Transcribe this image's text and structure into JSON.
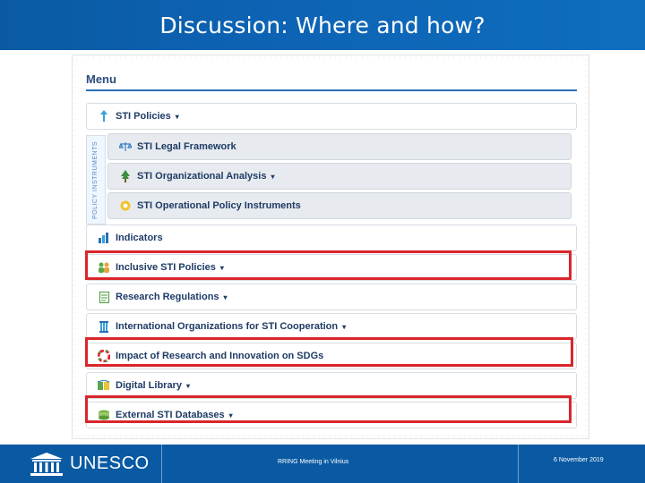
{
  "slide": {
    "title": "Discussion: Where and how?"
  },
  "menu": {
    "heading": "Menu",
    "side_label": "POLICY INSTRUMENTS",
    "items": [
      {
        "label": "STI Policies",
        "caret": "▾"
      },
      {
        "label": "STI Legal Framework",
        "caret": ""
      },
      {
        "label": "STI Organizational Analysis",
        "caret": "▾"
      },
      {
        "label": "STI Operational Policy Instruments",
        "caret": ""
      },
      {
        "label": "Indicators",
        "caret": ""
      },
      {
        "label": "Inclusive STI Policies",
        "caret": "▾"
      },
      {
        "label": "Research Regulations",
        "caret": "▾"
      },
      {
        "label": "International Organizations for STI Cooperation",
        "caret": "▾"
      },
      {
        "label": "Impact of Research and Innovation on SDGs",
        "caret": ""
      },
      {
        "label": "Digital Library",
        "caret": "▾"
      },
      {
        "label": "External STI Databases",
        "caret": "▾"
      }
    ]
  },
  "colors": {
    "brand_blue": "#0a5aa3",
    "highlight_red": "#d9262b"
  },
  "footer": {
    "brand": "UNESCO",
    "meeting": "RRING Meeting in Vilnius",
    "date": "6 November 2019"
  }
}
